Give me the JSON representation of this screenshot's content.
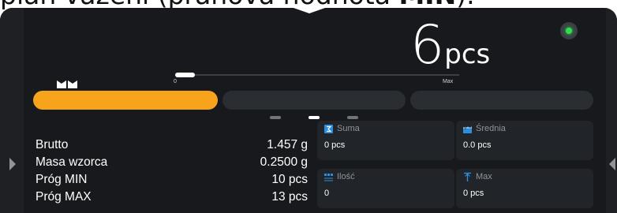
{
  "caption": {
    "text_before": "plan vážení (prahová hodnota ",
    "text_bold": "MIN",
    "text_after": ")."
  },
  "display": {
    "value": "6",
    "unit": "pcs",
    "stable_indicator_color": "#2ee04a"
  },
  "bargraph": {
    "zero_label": "0",
    "max_label": "Max",
    "level_fraction": 0.07
  },
  "segments": {
    "count": 3,
    "active_index": 0,
    "active_color": "#f7a31c"
  },
  "pager": {
    "pages": 3,
    "current": 1
  },
  "info": [
    {
      "label": "Brutto",
      "value": "1.457  g"
    },
    {
      "label": "Masa wzorca",
      "value": "0.2500 g"
    },
    {
      "label": "Próg MIN",
      "value": "10 pcs"
    },
    {
      "label": "Próg MAX",
      "value": "13 pcs"
    }
  ],
  "tiles": [
    {
      "name": "Suma",
      "value": "0 pcs",
      "icon": "sum-icon"
    },
    {
      "name": "Średnia",
      "value": "0.0 pcs",
      "icon": "average-icon"
    },
    {
      "name": "Ilość",
      "value": "0",
      "icon": "count-icon"
    },
    {
      "name": "Max",
      "value": "0 pcs",
      "icon": "max-icon"
    }
  ],
  "colors": {
    "accent": "#f7a31c",
    "icon_blue": "#2a8fe0",
    "background": "#17191c"
  }
}
